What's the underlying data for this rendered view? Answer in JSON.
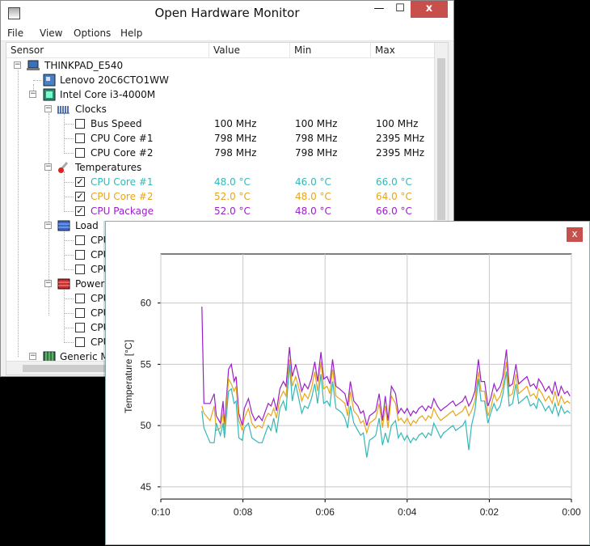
{
  "window": {
    "title": "Open Hardware Monitor",
    "min_glyph": "—",
    "max_glyph": "☐",
    "close_glyph": "x",
    "icon": "app-icon"
  },
  "menu": [
    "File",
    "View",
    "Options",
    "Help"
  ],
  "columns": {
    "sensor": "Sensor",
    "value": "Value",
    "min": "Min",
    "max": "Max"
  },
  "tree": {
    "computer": {
      "label": "THINKPAD_E540",
      "icon": "laptop-icon"
    },
    "mainboard": {
      "label": "Lenovo 20C6CTO1WW",
      "icon": "mainboard-icon"
    },
    "cpu": {
      "label": "Intel Core i3-4000M",
      "icon": "cpu-icon"
    },
    "clocks": {
      "label": "Clocks",
      "icon": "clock-icon",
      "items": [
        {
          "name": "Bus Speed",
          "value": "100 MHz",
          "min": "100 MHz",
          "max": "100 MHz",
          "checked": false
        },
        {
          "name": "CPU Core #1",
          "value": "798 MHz",
          "min": "798 MHz",
          "max": "2395 MHz",
          "checked": false
        },
        {
          "name": "CPU Core #2",
          "value": "798 MHz",
          "min": "798 MHz",
          "max": "2395 MHz",
          "checked": false
        }
      ]
    },
    "temperatures": {
      "label": "Temperatures",
      "icon": "thermometer-icon",
      "items": [
        {
          "name": "CPU Core #1",
          "value": "48.0 °C",
          "min": "46.0 °C",
          "max": "66.0 °C",
          "checked": true,
          "color": "#33b8b8"
        },
        {
          "name": "CPU Core #2",
          "value": "52.0 °C",
          "min": "48.0 °C",
          "max": "64.0 °C",
          "checked": true,
          "color": "#e6a619"
        },
        {
          "name": "CPU Package",
          "value": "52.0 °C",
          "min": "48.0 °C",
          "max": "66.0 °C",
          "checked": true,
          "color": "#9a1fc8"
        }
      ]
    },
    "load": {
      "label": "Load",
      "icon": "load-icon",
      "items": [
        {
          "name": "CPU",
          "checked": false
        },
        {
          "name": "CPU",
          "checked": false
        },
        {
          "name": "CPU",
          "checked": false
        }
      ]
    },
    "powers": {
      "label": "Powers",
      "icon": "power-icon",
      "items": [
        {
          "name": "CPU",
          "checked": false
        },
        {
          "name": "CPU",
          "checked": false
        },
        {
          "name": "CPU",
          "checked": false
        },
        {
          "name": "CPU",
          "checked": false
        }
      ]
    },
    "generic": {
      "label": "Generic M",
      "icon": "memory-icon"
    }
  },
  "plot": {
    "close_glyph": "x",
    "chart_data": {
      "type": "line",
      "ylabel": "Temperature [°C]",
      "xlabel": "",
      "y_ticks": [
        "45",
        "50",
        "55",
        "60"
      ],
      "x_ticks": [
        "0:10",
        "0:08",
        "0:06",
        "0:04",
        "0:02",
        "0:00"
      ],
      "ylim": [
        44,
        64
      ],
      "xlim": [
        600,
        0
      ],
      "x_unit": "seconds before now",
      "grid": true,
      "legend": "none",
      "series": [
        {
          "color": "#9a1fc8",
          "x": [
            540,
            537,
            528,
            522,
            519,
            513,
            509,
            507,
            501,
            497,
            493,
            490,
            486,
            481,
            478,
            472,
            467,
            462,
            457,
            452,
            447,
            443,
            439,
            435,
            431,
            426,
            421,
            417,
            412,
            408,
            403,
            397,
            394,
            390,
            385,
            380,
            375,
            371,
            366,
            362,
            357,
            353,
            349,
            344,
            339,
            335,
            331,
            327,
            323,
            318,
            312,
            308,
            304,
            299,
            295,
            290,
            286,
            281,
            276,
            272,
            268,
            263,
            257,
            253,
            249,
            244,
            240,
            235,
            231,
            227,
            223,
            218,
            213,
            209,
            205,
            201,
            196,
            191,
            187,
            182,
            178,
            173,
            169,
            164,
            159,
            155,
            150,
            146,
            141,
            136,
            132,
            127,
            122,
            118,
            113,
            109,
            104,
            100,
            95,
            91,
            86,
            81,
            77,
            73,
            69,
            65,
            60,
            55,
            51,
            48,
            43,
            38,
            33,
            28,
            24,
            19,
            15,
            10,
            6,
            2
          ],
          "y": [
            59.7,
            51.8,
            51.8,
            52.6,
            50.8,
            50.2,
            52.0,
            50.0,
            54.6,
            55.0,
            53.6,
            54.0,
            51.0,
            50.0,
            51.4,
            52.2,
            51.0,
            50.4,
            50.8,
            50.4,
            51.2,
            51.8,
            51.6,
            52.2,
            51.2,
            53.0,
            53.6,
            53.2,
            56.4,
            54.0,
            55.0,
            53.6,
            52.8,
            53.4,
            53.0,
            53.8,
            55.2,
            53.6,
            56.0,
            53.8,
            54.0,
            53.4,
            55.4,
            53.2,
            53.0,
            52.8,
            52.6,
            51.6,
            53.6,
            52.0,
            51.6,
            51.0,
            51.2,
            50.0,
            50.8,
            51.0,
            51.2,
            52.6,
            50.4,
            52.4,
            50.4,
            53.2,
            52.6,
            51.0,
            51.4,
            51.0,
            51.4,
            50.8,
            51.2,
            51.0,
            51.4,
            51.6,
            51.2,
            51.6,
            51.4,
            52.2,
            51.6,
            51.2,
            51.4,
            51.6,
            51.8,
            52.0,
            51.6,
            51.8,
            52.0,
            52.4,
            51.6,
            52.0,
            52.8,
            55.4,
            53.6,
            53.6,
            51.6,
            52.2,
            53.4,
            52.8,
            53.2,
            54.0,
            56.2,
            53.2,
            53.4,
            55.0,
            53.4,
            53.6,
            53.8,
            54.0,
            53.2,
            53.4,
            53.0,
            53.8,
            53.4,
            52.8,
            53.2,
            52.6,
            53.6,
            52.4,
            53.2,
            52.6,
            52.8,
            52.4
          ]
        },
        {
          "color": "#e6a619",
          "x": [
            540,
            537,
            528,
            522,
            519,
            513,
            509,
            507,
            501,
            497,
            493,
            490,
            486,
            481,
            478,
            472,
            467,
            462,
            457,
            452,
            447,
            443,
            439,
            435,
            431,
            426,
            421,
            417,
            412,
            408,
            403,
            397,
            394,
            390,
            385,
            380,
            375,
            371,
            366,
            362,
            357,
            353,
            349,
            344,
            339,
            335,
            331,
            327,
            323,
            318,
            312,
            308,
            304,
            299,
            295,
            290,
            286,
            281,
            276,
            272,
            268,
            263,
            257,
            253,
            249,
            244,
            240,
            235,
            231,
            227,
            223,
            218,
            213,
            209,
            205,
            201,
            196,
            191,
            187,
            182,
            178,
            173,
            169,
            164,
            159,
            155,
            150,
            146,
            141,
            136,
            132,
            127,
            122,
            118,
            113,
            109,
            104,
            100,
            95,
            91,
            86,
            81,
            77,
            73,
            69,
            65,
            60,
            55,
            51,
            48,
            43,
            38,
            33,
            28,
            24,
            19,
            15,
            10,
            6,
            2
          ],
          "y": [
            51.6,
            51.0,
            50.4,
            51.6,
            49.6,
            49.8,
            51.0,
            49.6,
            53.8,
            53.4,
            52.8,
            53.2,
            50.4,
            49.6,
            50.6,
            51.4,
            50.2,
            49.8,
            50.0,
            49.8,
            50.6,
            51.0,
            50.8,
            51.4,
            50.6,
            52.2,
            52.8,
            52.4,
            55.4,
            53.2,
            54.0,
            52.8,
            52.0,
            52.6,
            52.2,
            53.0,
            54.4,
            52.8,
            55.2,
            53.0,
            53.2,
            52.6,
            54.6,
            52.4,
            52.2,
            52.0,
            51.8,
            50.8,
            52.8,
            51.2,
            50.8,
            50.2,
            50.4,
            49.4,
            50.2,
            50.4,
            50.6,
            51.8,
            49.8,
            51.6,
            49.8,
            52.4,
            51.8,
            50.4,
            50.6,
            50.2,
            50.6,
            50.0,
            50.4,
            50.2,
            50.6,
            50.8,
            50.4,
            50.8,
            50.6,
            51.4,
            50.8,
            50.4,
            50.6,
            50.8,
            51.0,
            51.2,
            50.8,
            51.0,
            51.2,
            51.6,
            50.8,
            51.2,
            52.0,
            54.4,
            52.8,
            52.8,
            50.8,
            51.4,
            52.6,
            52.0,
            52.4,
            53.2,
            55.2,
            52.4,
            52.6,
            54.2,
            52.6,
            52.8,
            53.0,
            53.2,
            52.4,
            52.6,
            52.2,
            53.0,
            52.6,
            52.0,
            52.4,
            51.8,
            52.8,
            51.6,
            52.4,
            51.8,
            52.0,
            51.8
          ]
        },
        {
          "color": "#33b8b8",
          "x": [
            540,
            537,
            528,
            522,
            519,
            513,
            509,
            507,
            501,
            497,
            493,
            490,
            486,
            481,
            478,
            472,
            467,
            462,
            457,
            452,
            447,
            443,
            439,
            435,
            431,
            426,
            421,
            417,
            412,
            408,
            403,
            397,
            394,
            390,
            385,
            380,
            375,
            371,
            366,
            362,
            357,
            353,
            349,
            344,
            339,
            335,
            331,
            327,
            323,
            318,
            312,
            308,
            304,
            299,
            295,
            290,
            286,
            281,
            276,
            272,
            268,
            263,
            257,
            253,
            249,
            244,
            240,
            235,
            231,
            227,
            223,
            218,
            213,
            209,
            205,
            201,
            196,
            191,
            187,
            182,
            178,
            173,
            169,
            164,
            159,
            155,
            150,
            146,
            141,
            136,
            132,
            127,
            122,
            118,
            113,
            109,
            104,
            100,
            95,
            91,
            86,
            81,
            77,
            73,
            69,
            65,
            60,
            55,
            51,
            48,
            43,
            38,
            33,
            28,
            24,
            19,
            15,
            10,
            6,
            2
          ],
          "y": [
            51.2,
            49.8,
            48.6,
            48.6,
            50.2,
            49.2,
            50.2,
            49.0,
            52.8,
            53.0,
            51.8,
            52.0,
            49.0,
            48.8,
            49.8,
            50.2,
            49.0,
            48.8,
            48.6,
            48.6,
            49.4,
            50.0,
            49.6,
            50.6,
            49.4,
            51.4,
            52.0,
            51.2,
            55.0,
            52.0,
            53.4,
            51.8,
            51.0,
            51.6,
            51.4,
            52.2,
            53.4,
            51.8,
            54.2,
            51.8,
            52.0,
            51.6,
            53.6,
            51.4,
            51.2,
            51.0,
            50.6,
            49.8,
            51.6,
            50.2,
            49.6,
            49.2,
            49.4,
            47.4,
            48.8,
            49.0,
            49.2,
            50.6,
            48.4,
            49.4,
            48.6,
            50.0,
            50.4,
            49.0,
            49.4,
            48.8,
            49.2,
            48.6,
            49.0,
            48.8,
            49.2,
            49.4,
            49.0,
            49.4,
            49.2,
            50.2,
            49.6,
            49.0,
            49.4,
            49.6,
            49.8,
            50.0,
            49.6,
            49.8,
            50.0,
            50.4,
            48.0,
            50.0,
            51.2,
            53.8,
            52.0,
            52.0,
            50.2,
            51.0,
            51.8,
            51.2,
            51.6,
            52.6,
            54.4,
            51.6,
            51.8,
            53.4,
            51.8,
            52.0,
            52.2,
            52.4,
            51.6,
            51.8,
            51.4,
            52.2,
            51.8,
            51.2,
            51.6,
            51.0,
            51.8,
            50.8,
            51.6,
            51.0,
            51.2,
            51.0
          ]
        }
      ]
    }
  }
}
